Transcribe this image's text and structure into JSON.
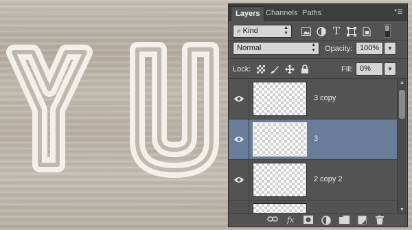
{
  "canvas": {
    "background": "wood-texture",
    "letters": [
      "Y",
      "U"
    ],
    "letter_color": "#f3efea"
  },
  "panel": {
    "tabs": [
      {
        "label": "Layers",
        "active": true
      },
      {
        "label": "Channels",
        "active": false
      },
      {
        "label": "Paths",
        "active": false
      }
    ],
    "menu_icon": "panel-menu-icon",
    "filter": {
      "kind_label": "Kind",
      "icons": [
        "image-filter-icon",
        "adjustment-filter-icon",
        "type-filter-icon",
        "shape-filter-icon",
        "smart-object-filter-icon"
      ]
    },
    "blend_mode": "Normal",
    "opacity_label": "Opacity:",
    "opacity_value": "100%",
    "lock_label": "Lock:",
    "lock_icons": [
      "lock-transparent-icon",
      "lock-image-icon",
      "lock-position-icon",
      "lock-all-icon"
    ],
    "fill_label": "Fill:",
    "fill_value": "0%",
    "layers": [
      {
        "name": "3 copy",
        "visible": true,
        "selected": false
      },
      {
        "name": "3",
        "visible": true,
        "selected": true
      },
      {
        "name": "2 copy 2",
        "visible": true,
        "selected": false
      },
      {
        "name": "",
        "visible": true,
        "selected": false
      }
    ],
    "footer_icons": [
      "link-layers-icon",
      "fx-icon",
      "add-mask-icon",
      "adjustment-layer-icon",
      "new-group-icon",
      "new-layer-icon",
      "delete-layer-icon"
    ],
    "fx_label": "fx",
    "colors": {
      "panel": "#535353",
      "selected_row": "#687d99"
    }
  }
}
